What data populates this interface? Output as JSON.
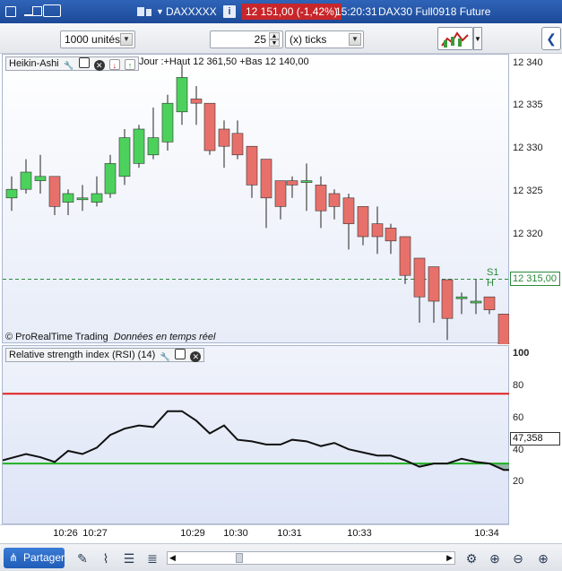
{
  "window": {
    "menu_icons": [
      "window-icon",
      "minimize-icon",
      "maximize-icon",
      "keyboard-icon"
    ],
    "instrument": "DAXXXXX",
    "info_label": "i",
    "price_change": "12 151,00 (-1,42%)",
    "time": "15:20:31",
    "description": "DAX30 Full0918 Future",
    "change_color": "#c8262a"
  },
  "toolbar": {
    "units_value": "1000 unités",
    "ticks_value": "25",
    "ticks_unit": "(x) ticks"
  },
  "price_panel": {
    "header": "Heikin-Ashi",
    "info": "Jour :+Haut 12 361,50 +Bas 12 140,00",
    "copyright": "© ProRealTime Trading",
    "realtime": "Données en temps réel",
    "support_label": "S1 H",
    "support_value": "12 315,00",
    "axis_ticks": [
      "12 340",
      "12 335",
      "12 330",
      "12 325",
      "12 320"
    ]
  },
  "rsi_panel": {
    "header": "Relative strength index (RSI) (14)",
    "current_value": "47,358",
    "axis_ticks": [
      "100",
      "80",
      "60",
      "40",
      "20"
    ]
  },
  "time_axis": {
    "labels": [
      "10:26",
      "10:27",
      "10:29",
      "10:30",
      "10:31",
      "10:33",
      "10:34"
    ]
  },
  "bottom_bar": {
    "share_label": "Partager"
  },
  "colors": {
    "bull": "#4cd25c",
    "bear": "#e8706a",
    "overbought_line": "#e02020",
    "oversold_line": "#20b020",
    "support_line": "#2a8a3a"
  }
}
